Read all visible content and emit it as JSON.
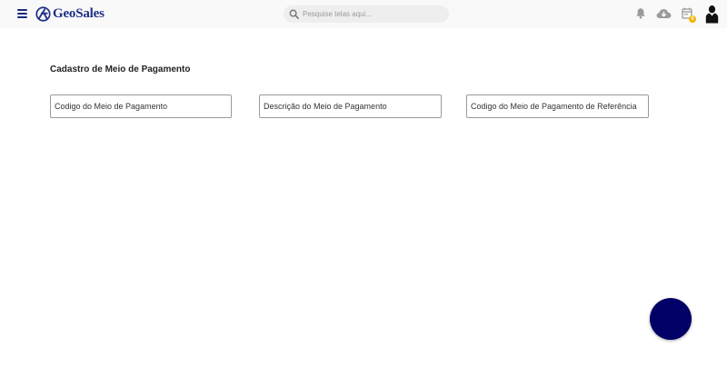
{
  "header": {
    "logo_text": "GeoSales",
    "search_placeholder": "Pesquise telas aqui...",
    "calendar_badge_count": "0",
    "icons": [
      "menu-icon",
      "geosales-logo-icon",
      "search-icon",
      "bell-icon",
      "cloud-download-icon",
      "calendar-icon",
      "user-avatar-icon"
    ],
    "brand_color": "#1f2f85"
  },
  "page": {
    "title": "Cadastro de Meio de Pagamento",
    "fields": [
      {
        "placeholder": "Codigo do Meio de Pagamento"
      },
      {
        "placeholder": "Descrição do Meio de Pagamento"
      },
      {
        "placeholder": "Codigo do Meio de Pagamento de Referência"
      }
    ]
  },
  "fab": {
    "icon": "fab-button",
    "color": "#000066"
  }
}
